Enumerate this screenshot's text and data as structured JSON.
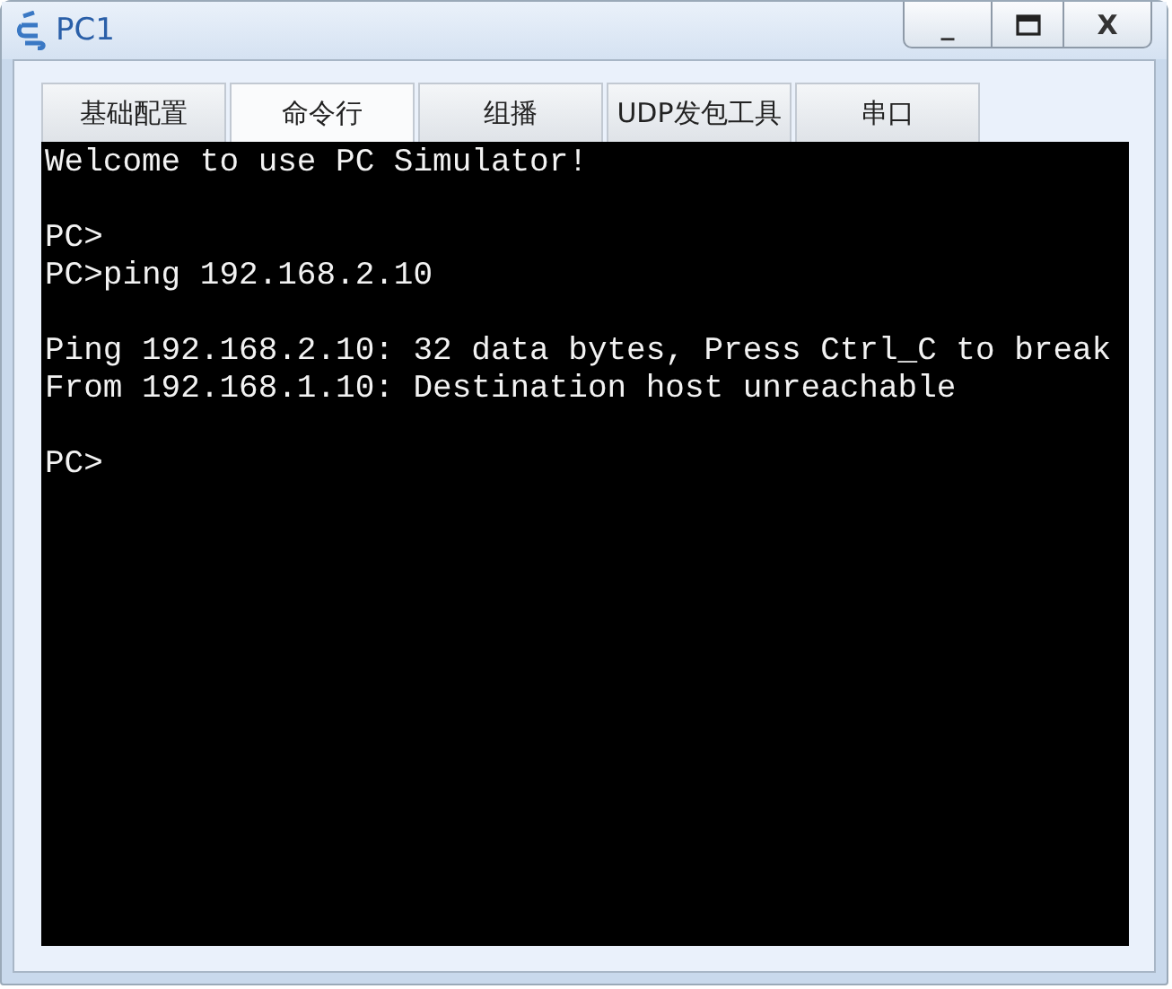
{
  "window": {
    "title": "PC1",
    "controls": [
      "_",
      "X"
    ]
  },
  "tabs": [
    {
      "label": "基础配置",
      "selected": false
    },
    {
      "label": "命令行",
      "selected": true
    },
    {
      "label": "组播",
      "selected": false
    },
    {
      "label": "UDP发包工具",
      "selected": false
    },
    {
      "label": "串口",
      "selected": false
    }
  ],
  "terminal": {
    "blocks": [
      [
        "Welcome to use PC Simulator!"
      ],
      [
        "PC>",
        "PC>ping 192.168.2.10"
      ],
      [
        "Ping 192.168.2.10: 32 data bytes, Press Ctrl_C to break",
        "From 192.168.1.10: Destination host unreachable"
      ],
      [
        "PC>"
      ]
    ]
  }
}
